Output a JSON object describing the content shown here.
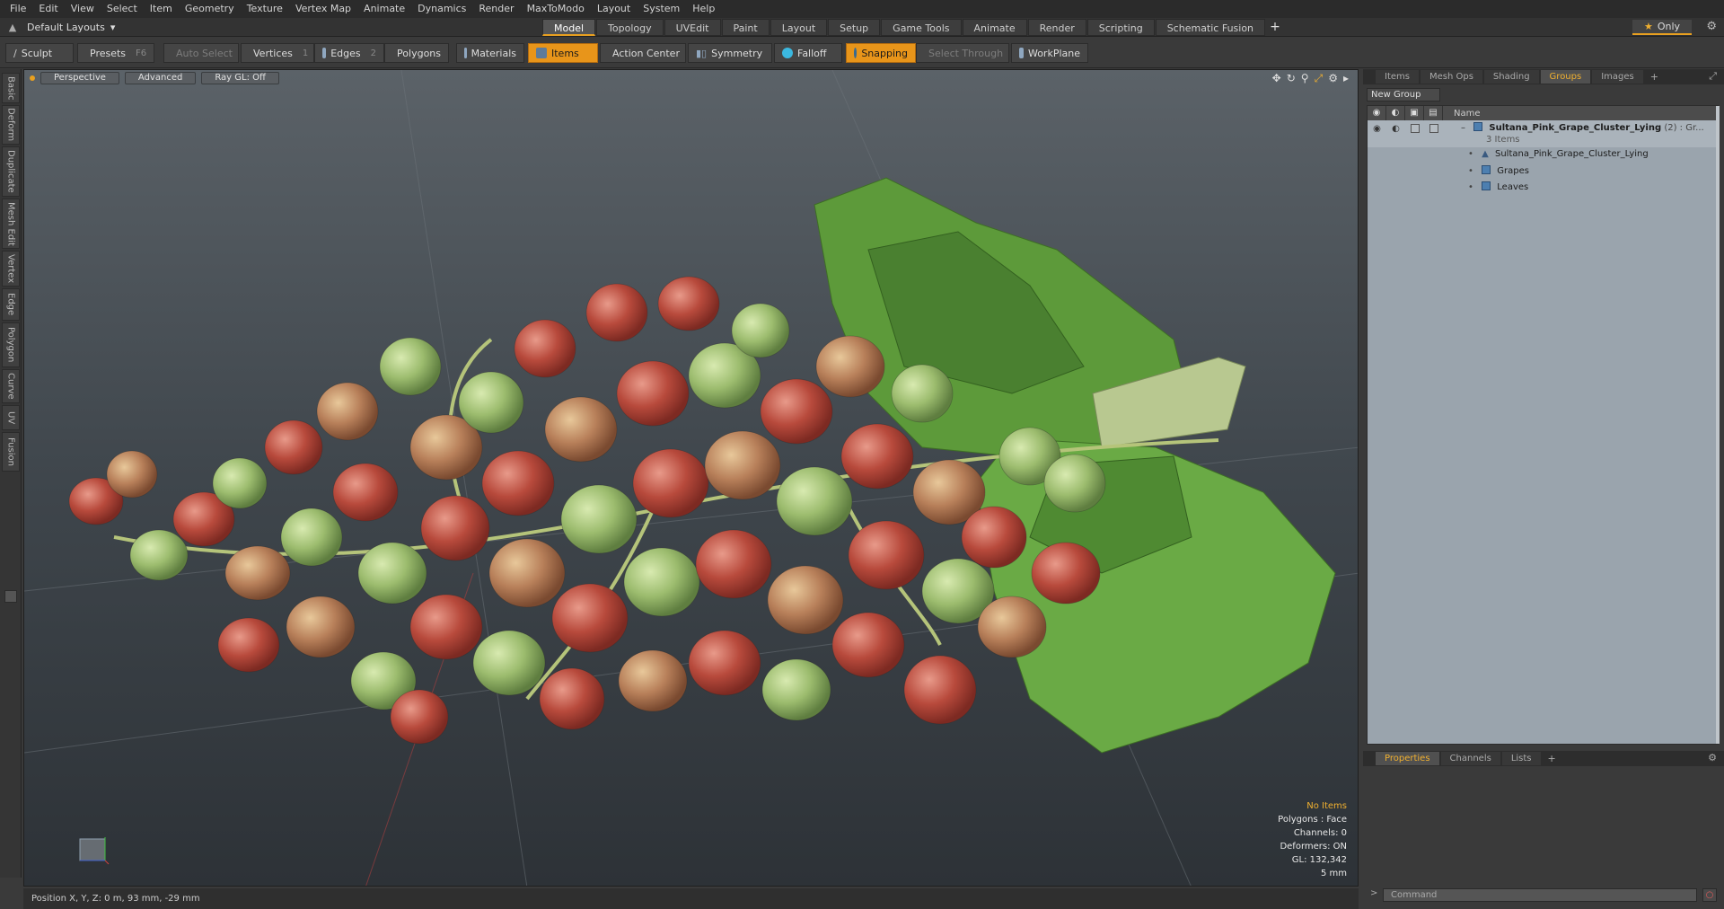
{
  "menu": [
    "File",
    "Edit",
    "View",
    "Select",
    "Item",
    "Geometry",
    "Texture",
    "Vertex Map",
    "Animate",
    "Dynamics",
    "Render",
    "MaxToModo",
    "Layout",
    "System",
    "Help"
  ],
  "layout_selector": "Default Layouts",
  "layout_tabs": [
    {
      "label": "Model",
      "active": true
    },
    {
      "label": "Topology"
    },
    {
      "label": "UVEdit"
    },
    {
      "label": "Paint"
    },
    {
      "label": "Layout"
    },
    {
      "label": "Setup"
    },
    {
      "label": "Game Tools"
    },
    {
      "label": "Animate"
    },
    {
      "label": "Render"
    },
    {
      "label": "Scripting"
    },
    {
      "label": "Schematic Fusion"
    }
  ],
  "only_button": "Only",
  "toolbar": {
    "sculpt": "Sculpt",
    "presets": "Presets",
    "presets_key": "F6",
    "auto_select": "Auto Select",
    "vertices": "Vertices",
    "vertices_key": "1",
    "edges": "Edges",
    "edges_key": "2",
    "polygons": "Polygons",
    "materials": "Materials",
    "items": "Items",
    "action_center": "Action Center",
    "symmetry": "Symmetry",
    "falloff": "Falloff",
    "snapping": "Snapping",
    "select_through": "Select Through",
    "workplane": "WorkPlane"
  },
  "left_tabs": [
    "Basic",
    "Deform",
    "Duplicate",
    "Mesh Edit",
    "Vertex",
    "Edge",
    "Polygon",
    "Curve",
    "UV",
    "Fusion"
  ],
  "viewport": {
    "view": "Perspective",
    "mode": "Advanced",
    "raygl": "Ray GL: Off",
    "info": {
      "items": "No Items",
      "polygons": "Polygons : Face",
      "channels": "Channels: 0",
      "deformers": "Deformers: ON",
      "gl": "GL: 132,342",
      "scale": "5 mm"
    }
  },
  "status": "Position X, Y, Z:  0 m, 93 mm, -29 mm",
  "right_panel": {
    "tabs": [
      {
        "label": "Items"
      },
      {
        "label": "Mesh Ops"
      },
      {
        "label": "Shading"
      },
      {
        "label": "Groups",
        "active": true
      },
      {
        "label": "Images"
      }
    ],
    "new_group": "New Group",
    "column_name": "Name",
    "group": {
      "name": "Sultana_Pink_Grape_Cluster_Lying",
      "count": "(2) : Gr...",
      "sub": "3 Items",
      "children": [
        "Sultana_Pink_Grape_Cluster_Lying",
        "Grapes",
        "Leaves"
      ]
    },
    "bottom_tabs": [
      {
        "label": "Properties",
        "active": true
      },
      {
        "label": "Channels"
      },
      {
        "label": "Lists"
      }
    ],
    "command_placeholder": "Command"
  },
  "colors": {
    "accent": "#e8951a",
    "active_tab_text": "#f0b030",
    "groups_bg": "#9aa4ad"
  }
}
